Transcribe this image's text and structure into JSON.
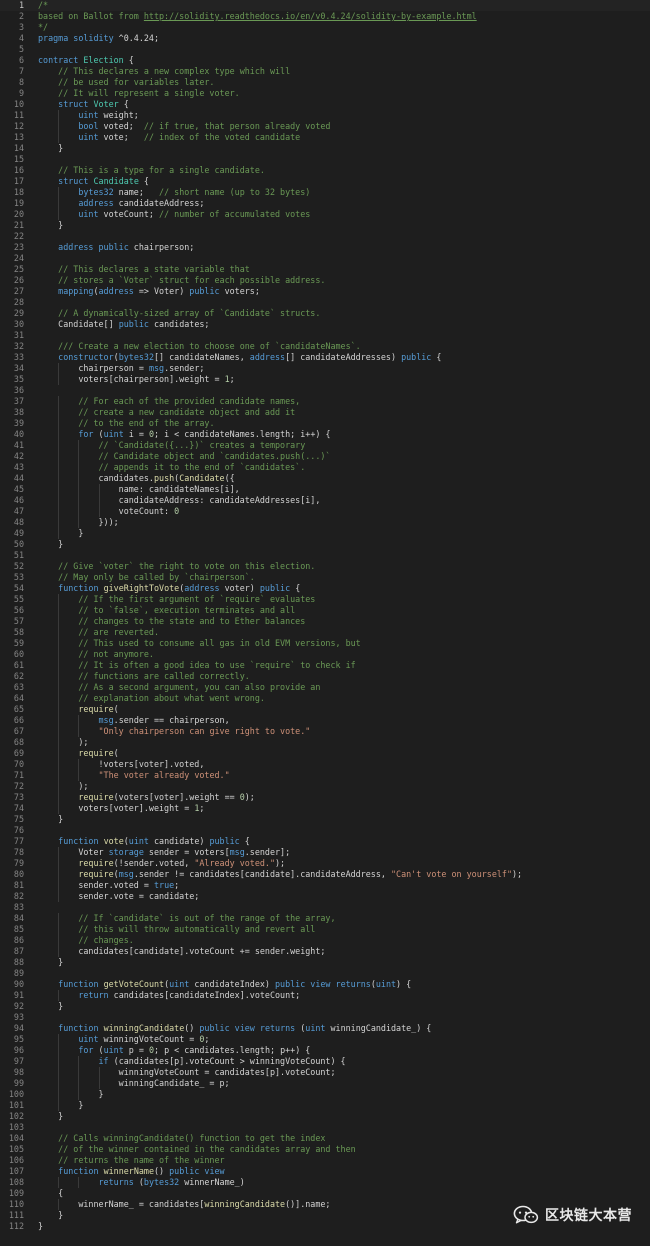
{
  "editor": {
    "language": "solidity",
    "theme": "dark",
    "active_line": 1,
    "lines": [
      [
        [
          "c",
          "/*"
        ]
      ],
      [
        [
          "c",
          "based on Ballot from "
        ],
        [
          "cu",
          "http://solidity.readthedocs.io/en/v0.4.24/solidity-by-example.html"
        ]
      ],
      [
        [
          "c",
          "*/"
        ]
      ],
      [
        [
          "k",
          "pragma solidity"
        ],
        [
          "p",
          " ^0.4.24;"
        ]
      ],
      [],
      [
        [
          "k",
          "contract"
        ],
        [
          "p",
          " "
        ],
        [
          "t",
          "Election"
        ],
        [
          "p",
          " {"
        ]
      ],
      [
        [
          "p",
          "    "
        ],
        [
          "c",
          "// This declares a new complex type which will"
        ]
      ],
      [
        [
          "p",
          "    "
        ],
        [
          "c",
          "// be used for variables later."
        ]
      ],
      [
        [
          "p",
          "    "
        ],
        [
          "c",
          "// It will represent a single voter."
        ]
      ],
      [
        [
          "p",
          "    "
        ],
        [
          "k",
          "struct"
        ],
        [
          "p",
          " "
        ],
        [
          "t",
          "Voter"
        ],
        [
          "p",
          " {"
        ]
      ],
      [
        [
          "p",
          "        "
        ],
        [
          "k",
          "uint"
        ],
        [
          "p",
          " weight;"
        ]
      ],
      [
        [
          "p",
          "        "
        ],
        [
          "k",
          "bool"
        ],
        [
          "p",
          " voted;  "
        ],
        [
          "c",
          "// if true, that person already voted"
        ]
      ],
      [
        [
          "p",
          "        "
        ],
        [
          "k",
          "uint"
        ],
        [
          "p",
          " vote;   "
        ],
        [
          "c",
          "// index of the voted candidate"
        ]
      ],
      [
        [
          "p",
          "    }"
        ]
      ],
      [],
      [
        [
          "p",
          "    "
        ],
        [
          "c",
          "// This is a type for a single candidate."
        ]
      ],
      [
        [
          "p",
          "    "
        ],
        [
          "k",
          "struct"
        ],
        [
          "p",
          " "
        ],
        [
          "t",
          "Candidate"
        ],
        [
          "p",
          " {"
        ]
      ],
      [
        [
          "p",
          "        "
        ],
        [
          "k",
          "bytes32"
        ],
        [
          "p",
          " name;   "
        ],
        [
          "c",
          "// short name (up to 32 bytes)"
        ]
      ],
      [
        [
          "p",
          "        "
        ],
        [
          "k",
          "address"
        ],
        [
          "p",
          " candidateAddress;"
        ]
      ],
      [
        [
          "p",
          "        "
        ],
        [
          "k",
          "uint"
        ],
        [
          "p",
          " voteCount; "
        ],
        [
          "c",
          "// number of accumulated votes"
        ]
      ],
      [
        [
          "p",
          "    }"
        ]
      ],
      [],
      [
        [
          "p",
          "    "
        ],
        [
          "k",
          "address public"
        ],
        [
          "p",
          " chairperson;"
        ]
      ],
      [],
      [
        [
          "p",
          "    "
        ],
        [
          "c",
          "// This declares a state variable that"
        ]
      ],
      [
        [
          "p",
          "    "
        ],
        [
          "c",
          "// stores a `Voter` struct for each possible address."
        ]
      ],
      [
        [
          "p",
          "    "
        ],
        [
          "k",
          "mapping"
        ],
        [
          "p",
          "("
        ],
        [
          "k",
          "address"
        ],
        [
          "p",
          " => Voter) "
        ],
        [
          "k",
          "public"
        ],
        [
          "p",
          " voters;"
        ]
      ],
      [],
      [
        [
          "p",
          "    "
        ],
        [
          "c",
          "// A dynamically-sized array of `Candidate` structs."
        ]
      ],
      [
        [
          "p",
          "    Candidate[] "
        ],
        [
          "k",
          "public"
        ],
        [
          "p",
          " candidates;"
        ]
      ],
      [],
      [
        [
          "p",
          "    "
        ],
        [
          "c",
          "/// Create a new election to choose one of `candidateNames`."
        ]
      ],
      [
        [
          "p",
          "    "
        ],
        [
          "k",
          "constructor"
        ],
        [
          "p",
          "("
        ],
        [
          "k",
          "bytes32"
        ],
        [
          "p",
          "[] candidateNames, "
        ],
        [
          "k",
          "address"
        ],
        [
          "p",
          "[] candidateAddresses) "
        ],
        [
          "k",
          "public"
        ],
        [
          "p",
          " {"
        ]
      ],
      [
        [
          "p",
          "        chairperson = "
        ],
        [
          "k",
          "msg"
        ],
        [
          "p",
          ".sender;"
        ]
      ],
      [
        [
          "p",
          "        voters[chairperson].weight = "
        ],
        [
          "n",
          "1"
        ],
        [
          "p",
          ";"
        ]
      ],
      [],
      [
        [
          "p",
          "        "
        ],
        [
          "c",
          "// For each of the provided candidate names,"
        ]
      ],
      [
        [
          "p",
          "        "
        ],
        [
          "c",
          "// create a new candidate object and add it"
        ]
      ],
      [
        [
          "p",
          "        "
        ],
        [
          "c",
          "// to the end of the array."
        ]
      ],
      [
        [
          "p",
          "        "
        ],
        [
          "k",
          "for"
        ],
        [
          "p",
          " ("
        ],
        [
          "k",
          "uint"
        ],
        [
          "p",
          " i = "
        ],
        [
          "n",
          "0"
        ],
        [
          "p",
          "; i < candidateNames.length; i++) {"
        ]
      ],
      [
        [
          "p",
          "            "
        ],
        [
          "c",
          "// `Candidate({...})` creates a temporary"
        ]
      ],
      [
        [
          "p",
          "            "
        ],
        [
          "c",
          "// Candidate object and `candidates.push(...)`"
        ]
      ],
      [
        [
          "p",
          "            "
        ],
        [
          "c",
          "// appends it to the end of `candidates`."
        ]
      ],
      [
        [
          "p",
          "            candidates."
        ],
        [
          "f",
          "push"
        ],
        [
          "p",
          "("
        ],
        [
          "f",
          "Candidate"
        ],
        [
          "p",
          "({"
        ]
      ],
      [
        [
          "p",
          "                name: candidateNames[i],"
        ]
      ],
      [
        [
          "p",
          "                candidateAddress: candidateAddresses[i],"
        ]
      ],
      [
        [
          "p",
          "                voteCount: "
        ],
        [
          "n",
          "0"
        ]
      ],
      [
        [
          "p",
          "            }));"
        ]
      ],
      [
        [
          "p",
          "        }"
        ]
      ],
      [
        [
          "p",
          "    }"
        ]
      ],
      [],
      [
        [
          "p",
          "    "
        ],
        [
          "c",
          "// Give `voter` the right to vote on this election."
        ]
      ],
      [
        [
          "p",
          "    "
        ],
        [
          "c",
          "// May only be called by `chairperson`."
        ]
      ],
      [
        [
          "p",
          "    "
        ],
        [
          "k",
          "function"
        ],
        [
          "p",
          " "
        ],
        [
          "f",
          "giveRightToVote"
        ],
        [
          "p",
          "("
        ],
        [
          "k",
          "address"
        ],
        [
          "p",
          " voter) "
        ],
        [
          "k",
          "public"
        ],
        [
          "p",
          " {"
        ]
      ],
      [
        [
          "p",
          "        "
        ],
        [
          "c",
          "// If the first argument of `require` evaluates"
        ]
      ],
      [
        [
          "p",
          "        "
        ],
        [
          "c",
          "// to `false`, execution terminates and all"
        ]
      ],
      [
        [
          "p",
          "        "
        ],
        [
          "c",
          "// changes to the state and to Ether balances"
        ]
      ],
      [
        [
          "p",
          "        "
        ],
        [
          "c",
          "// are reverted."
        ]
      ],
      [
        [
          "p",
          "        "
        ],
        [
          "c",
          "// This used to consume all gas in old EVM versions, but"
        ]
      ],
      [
        [
          "p",
          "        "
        ],
        [
          "c",
          "// not anymore."
        ]
      ],
      [
        [
          "p",
          "        "
        ],
        [
          "c",
          "// It is often a good idea to use `require` to check if"
        ]
      ],
      [
        [
          "p",
          "        "
        ],
        [
          "c",
          "// functions are called correctly."
        ]
      ],
      [
        [
          "p",
          "        "
        ],
        [
          "c",
          "// As a second argument, you can also provide an"
        ]
      ],
      [
        [
          "p",
          "        "
        ],
        [
          "c",
          "// explanation about what went wrong."
        ]
      ],
      [
        [
          "p",
          "        "
        ],
        [
          "f",
          "require"
        ],
        [
          "p",
          "("
        ]
      ],
      [
        [
          "p",
          "            "
        ],
        [
          "k",
          "msg"
        ],
        [
          "p",
          ".sender == chairperson,"
        ]
      ],
      [
        [
          "p",
          "            "
        ],
        [
          "s",
          "\"Only chairperson can give right to vote.\""
        ]
      ],
      [
        [
          "p",
          "        );"
        ]
      ],
      [
        [
          "p",
          "        "
        ],
        [
          "f",
          "require"
        ],
        [
          "p",
          "("
        ]
      ],
      [
        [
          "p",
          "            !voters[voter].voted,"
        ]
      ],
      [
        [
          "p",
          "            "
        ],
        [
          "s",
          "\"The voter already voted.\""
        ]
      ],
      [
        [
          "p",
          "        );"
        ]
      ],
      [
        [
          "p",
          "        "
        ],
        [
          "f",
          "require"
        ],
        [
          "p",
          "(voters[voter].weight == "
        ],
        [
          "n",
          "0"
        ],
        [
          "p",
          ");"
        ]
      ],
      [
        [
          "p",
          "        voters[voter].weight = "
        ],
        [
          "n",
          "1"
        ],
        [
          "p",
          ";"
        ]
      ],
      [
        [
          "p",
          "    }"
        ]
      ],
      [],
      [
        [
          "p",
          "    "
        ],
        [
          "k",
          "function"
        ],
        [
          "p",
          " "
        ],
        [
          "f",
          "vote"
        ],
        [
          "p",
          "("
        ],
        [
          "k",
          "uint"
        ],
        [
          "p",
          " candidate) "
        ],
        [
          "k",
          "public"
        ],
        [
          "p",
          " {"
        ]
      ],
      [
        [
          "p",
          "        Voter "
        ],
        [
          "k",
          "storage"
        ],
        [
          "p",
          " sender = voters["
        ],
        [
          "k",
          "msg"
        ],
        [
          "p",
          ".sender];"
        ]
      ],
      [
        [
          "p",
          "        "
        ],
        [
          "f",
          "require"
        ],
        [
          "p",
          "(!sender.voted, "
        ],
        [
          "s",
          "\"Already voted.\""
        ],
        [
          "p",
          ");"
        ]
      ],
      [
        [
          "p",
          "        "
        ],
        [
          "f",
          "require"
        ],
        [
          "p",
          "("
        ],
        [
          "k",
          "msg"
        ],
        [
          "p",
          ".sender != candidates[candidate].candidateAddress, "
        ],
        [
          "s",
          "\"Can't vote on yourself\""
        ],
        [
          "p",
          ");"
        ]
      ],
      [
        [
          "p",
          "        sender.voted = "
        ],
        [
          "k",
          "true"
        ],
        [
          "p",
          ";"
        ]
      ],
      [
        [
          "p",
          "        sender.vote = candidate;"
        ]
      ],
      [],
      [
        [
          "p",
          "        "
        ],
        [
          "c",
          "// If `candidate` is out of the range of the array,"
        ]
      ],
      [
        [
          "p",
          "        "
        ],
        [
          "c",
          "// this will throw automatically and revert all"
        ]
      ],
      [
        [
          "p",
          "        "
        ],
        [
          "c",
          "// changes."
        ]
      ],
      [
        [
          "p",
          "        candidates[candidate].voteCount += sender.weight;"
        ]
      ],
      [
        [
          "p",
          "    }"
        ]
      ],
      [],
      [
        [
          "p",
          "    "
        ],
        [
          "k",
          "function"
        ],
        [
          "p",
          " "
        ],
        [
          "f",
          "getVoteCount"
        ],
        [
          "p",
          "("
        ],
        [
          "k",
          "uint"
        ],
        [
          "p",
          " candidateIndex) "
        ],
        [
          "k",
          "public view returns"
        ],
        [
          "p",
          "("
        ],
        [
          "k",
          "uint"
        ],
        [
          "p",
          ") {"
        ]
      ],
      [
        [
          "p",
          "        "
        ],
        [
          "k",
          "return"
        ],
        [
          "p",
          " candidates[candidateIndex].voteCount;"
        ]
      ],
      [
        [
          "p",
          "    }"
        ]
      ],
      [],
      [
        [
          "p",
          "    "
        ],
        [
          "k",
          "function"
        ],
        [
          "p",
          " "
        ],
        [
          "f",
          "winningCandidate"
        ],
        [
          "p",
          "() "
        ],
        [
          "k",
          "public view returns"
        ],
        [
          "p",
          " ("
        ],
        [
          "k",
          "uint"
        ],
        [
          "p",
          " winningCandidate_) {"
        ]
      ],
      [
        [
          "p",
          "        "
        ],
        [
          "k",
          "uint"
        ],
        [
          "p",
          " winningVoteCount = "
        ],
        [
          "n",
          "0"
        ],
        [
          "p",
          ";"
        ]
      ],
      [
        [
          "p",
          "        "
        ],
        [
          "k",
          "for"
        ],
        [
          "p",
          " ("
        ],
        [
          "k",
          "uint"
        ],
        [
          "p",
          " p = "
        ],
        [
          "n",
          "0"
        ],
        [
          "p",
          "; p < candidates.length; p++) {"
        ]
      ],
      [
        [
          "p",
          "            "
        ],
        [
          "k",
          "if"
        ],
        [
          "p",
          " (candidates[p].voteCount > winningVoteCount) {"
        ]
      ],
      [
        [
          "p",
          "                winningVoteCount = candidates[p].voteCount;"
        ]
      ],
      [
        [
          "p",
          "                winningCandidate_ = p;"
        ]
      ],
      [
        [
          "p",
          "            }"
        ]
      ],
      [
        [
          "p",
          "        }"
        ]
      ],
      [
        [
          "p",
          "    }"
        ]
      ],
      [],
      [
        [
          "p",
          "    "
        ],
        [
          "c",
          "// Calls winningCandidate() function to get the index"
        ]
      ],
      [
        [
          "p",
          "    "
        ],
        [
          "c",
          "// of the winner contained in the candidates array and then"
        ]
      ],
      [
        [
          "p",
          "    "
        ],
        [
          "c",
          "// returns the name of the winner"
        ]
      ],
      [
        [
          "p",
          "    "
        ],
        [
          "k",
          "function"
        ],
        [
          "p",
          " "
        ],
        [
          "f",
          "winnerName"
        ],
        [
          "p",
          "() "
        ],
        [
          "k",
          "public view"
        ]
      ],
      [
        [
          "p",
          "            "
        ],
        [
          "k",
          "returns"
        ],
        [
          "p",
          " ("
        ],
        [
          "k",
          "bytes32"
        ],
        [
          "p",
          " winnerName_)"
        ]
      ],
      [
        [
          "p",
          "    {"
        ]
      ],
      [
        [
          "p",
          "        winnerName_ = candidates["
        ],
        [
          "f",
          "winningCandidate"
        ],
        [
          "p",
          "()].name;"
        ]
      ],
      [
        [
          "p",
          "    }"
        ]
      ],
      [
        [
          "p",
          "}"
        ]
      ]
    ]
  },
  "watermark": {
    "icon": "wechat-icon",
    "text": "区块链大本营"
  }
}
